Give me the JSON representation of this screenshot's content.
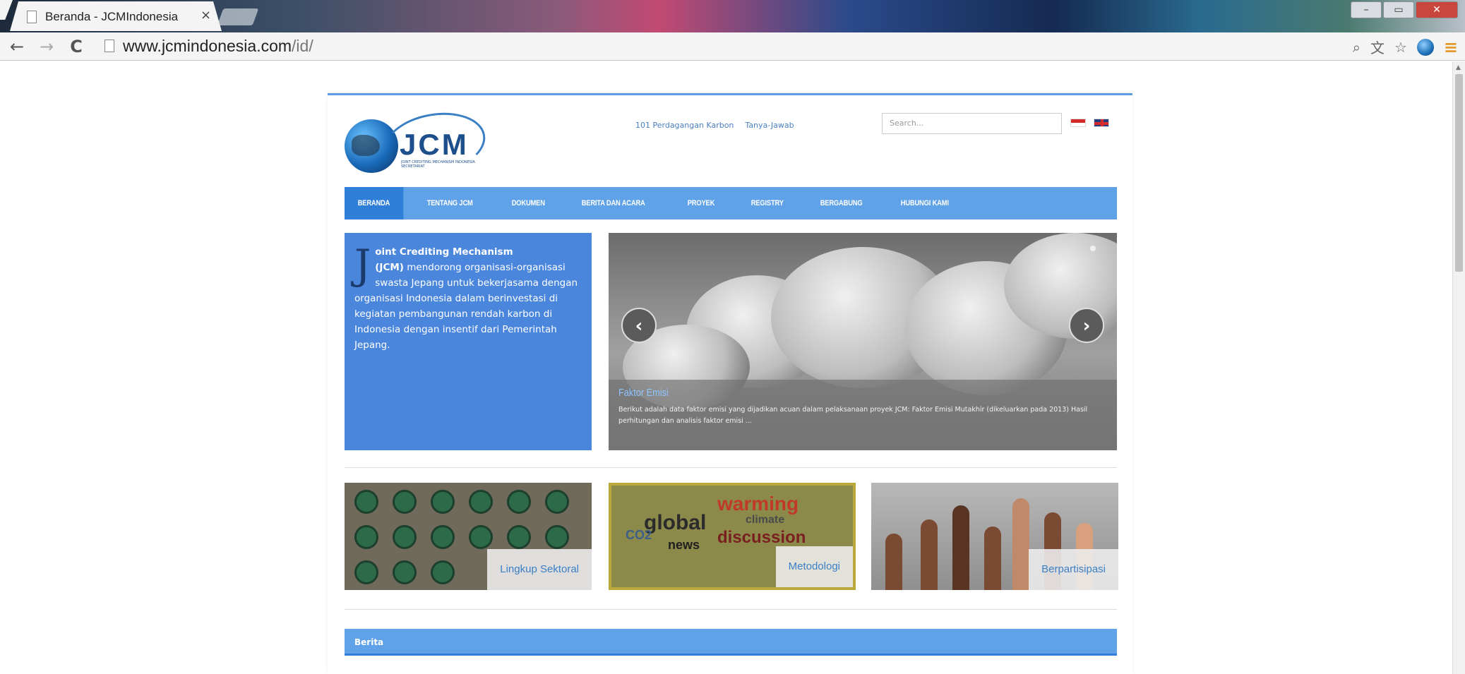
{
  "browser": {
    "tab_title": "Beranda - JCMIndonesia",
    "tab_close": "×",
    "url_host": "www.jcmindonesia.com",
    "url_path": "/id/",
    "nav_back": "←",
    "nav_forward": "→",
    "nav_reload": "C",
    "icons": [
      "zoom-icon",
      "translate-icon",
      "star-icon",
      "extension-icon",
      "menu-icon"
    ],
    "window_buttons": [
      "minimize",
      "maximize",
      "close"
    ]
  },
  "header": {
    "logo_text": "JCM",
    "logo_subtext": "JOINT CREDITING MECHANISM INDONESIA SECRETARIAT",
    "top_links": [
      "101 Perdagangan Karbon",
      "Tanya-Jawab"
    ],
    "search_placeholder": "Search..."
  },
  "nav": {
    "items": [
      "BERANDA",
      "TENTANG JCM",
      "DOKUMEN",
      "BERITA DAN ACARA",
      "PROYEK",
      "REGISTRY",
      "BERGABUNG",
      "HUBUNGI KAMI"
    ],
    "active": "BERANDA"
  },
  "intro": {
    "dropcap": "J",
    "bold1": "oint Crediting Mechanism",
    "bold2": "(JCM)",
    "text": " mendorong organisasi-organisasi swasta Jepang untuk bekerjasama dengan organisasi Indonesia dalam berinvestasi di kegiatan pembangunan rendah karbon di Indonesia dengan insentif dari Pemerintah Jepang."
  },
  "slider": {
    "title": "Faktor Emisi",
    "text": "Berikut adalah data faktor emisi yang dijadikan acuan dalam pelaksanaan proyek JCM: Faktor Emisi Mutakhir (dikeluarkan pada 2013) Hasil perhitungan dan analisis faktor emisi ...",
    "prev": "‹",
    "next": "›"
  },
  "tiles": [
    {
      "label": "Lingkup Sektoral"
    },
    {
      "label": "Metodologi",
      "words": [
        "warming",
        "global",
        "discussion",
        "CO2",
        "news",
        "climate"
      ]
    },
    {
      "label": "Berpartisipasi"
    }
  ],
  "news": {
    "title": "Berita"
  },
  "colors": {
    "accent": "#5fa2e8",
    "active": "#2f7fd8",
    "intro_bg": "#4a86dc",
    "link": "#4a7fc0"
  }
}
